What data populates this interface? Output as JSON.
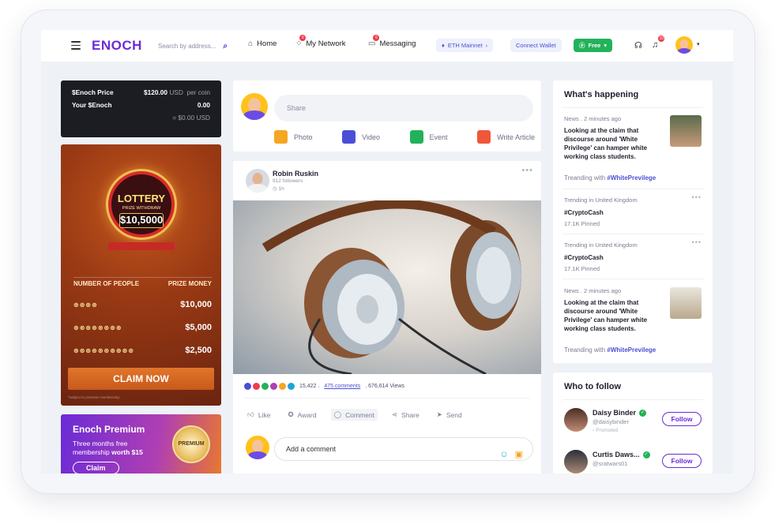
{
  "brand": {
    "logo": "ENOCH",
    "accent": "#6c2bd9"
  },
  "header": {
    "search_placeholder": "Search by address...",
    "nav": [
      {
        "label": "Home",
        "icon": "home-icon"
      },
      {
        "label": "My Network",
        "icon": "network-icon",
        "badge": "6"
      },
      {
        "label": "Messaging",
        "icon": "message-icon",
        "badge": "6"
      }
    ],
    "network_label": "ETH Mainnet",
    "wallet_label": "Connect Wallet",
    "plan_label": "Free",
    "notifications_badge": "10"
  },
  "price_card": {
    "price_label": "$Enoch Price",
    "price_value": "$120.00",
    "price_unit": "USD",
    "price_per": "per coin",
    "your_label": "Your $Enoch",
    "your_value": "0.00",
    "your_usd": "= $0.00 USD"
  },
  "lottery": {
    "title": "LOTTERY",
    "subtitle": "PRIZE WITHDRAW",
    "amount": "$10,5000",
    "col_people": "NUMBER OF PEOPLE",
    "col_prize": "PRIZE MONEY",
    "rows": [
      {
        "coins": "⊛⊛⊛⊛",
        "prize": "$10,000"
      },
      {
        "coins": "⊛⊛⊛⊛⊛⊛⊛⊛",
        "prize": "$5,000"
      },
      {
        "coins": "⊛⊛⊛⊛⊛⊛⊛⊛⊛⊛",
        "prize": "$2,500"
      }
    ],
    "cta": "CLAIM NOW",
    "fine_print": "*subject to premium membership"
  },
  "premium": {
    "title": "Enoch Premium",
    "line1": "Three months free",
    "line2": "membership",
    "line2_bold": "worth $15",
    "cta": "Claim",
    "seal": "PREMIUM"
  },
  "composer": {
    "placeholder": "Share",
    "options": [
      {
        "label": "Photo",
        "color": "#f5a623"
      },
      {
        "label": "Video",
        "color": "#4b4fd6"
      },
      {
        "label": "Event",
        "color": "#22b25a"
      },
      {
        "label": "Write Article",
        "color": "#f0563a"
      }
    ]
  },
  "post": {
    "author": "Robin Ruskin",
    "followers": "912 followers",
    "time": "1h",
    "reactions_count": "15,422 .",
    "comments_link": "475 comments",
    "views": ". 676,614 Views",
    "actions": [
      "Like",
      "Award",
      "Comment",
      "Share",
      "Send"
    ],
    "comment_placeholder": "Add a comment"
  },
  "whats_happening": {
    "title": "What's happening",
    "items": [
      {
        "meta": "News . 2 minutes ago",
        "text": "Looking at the claim that discourse around 'White Privilege' can hamper white working class students.",
        "tag_prefix": "Treanding with",
        "tag": "#WhitePrevilege"
      },
      {
        "meta": "Trending in United Kingdom",
        "text": "#CryptoCash",
        "sub": "17.1K Pinned"
      },
      {
        "meta": "Trending in United Kingdom",
        "text": "#CryptoCash",
        "sub": "17.1K Pinned"
      },
      {
        "meta": "News . 2 minutes ago",
        "text": "Looking at the claim that discourse around 'White Privilege' can hamper white working class students.",
        "tag_prefix": "Treanding with",
        "tag": "#WhitePrevilege"
      }
    ]
  },
  "who_to_follow": {
    "title": "Who to follow",
    "people": [
      {
        "name": "Daisy Binder",
        "handle": "@daisybinder",
        "promo": "Promoted",
        "button": "Follow"
      },
      {
        "name": "Curtis Daws...",
        "handle": "@sratwars01",
        "button": "Follow"
      }
    ]
  }
}
